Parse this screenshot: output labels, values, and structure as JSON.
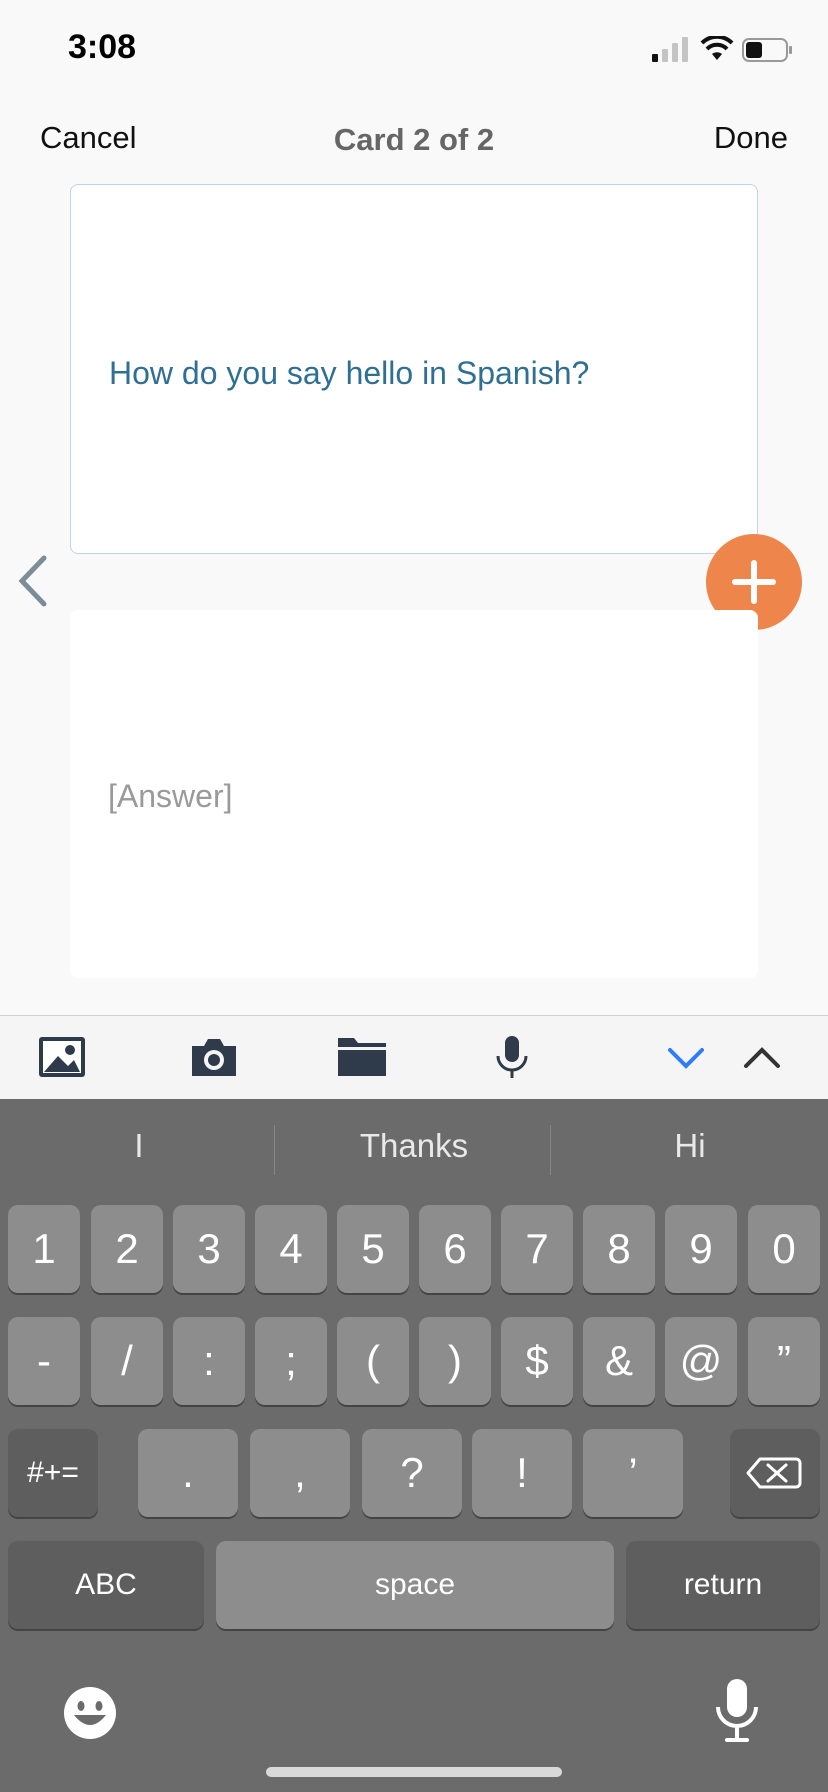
{
  "status": {
    "time": "3:08"
  },
  "nav": {
    "cancel": "Cancel",
    "title": "Card 2 of 2",
    "done": "Done"
  },
  "cards": {
    "front_text": "How do you say hello in Spanish?",
    "back_placeholder": "[Answer]"
  },
  "colors": {
    "accent_orange": "#ee854a",
    "front_text": "#2f6f94",
    "chevron_blue": "#2f7cf6"
  },
  "toolbar": {
    "icons": [
      "image-icon",
      "camera-icon",
      "folder-icon",
      "microphone-icon",
      "chevron-down-icon",
      "chevron-up-icon"
    ]
  },
  "keyboard": {
    "suggestions": [
      "I",
      "Thanks",
      "Hi"
    ],
    "row1": [
      "1",
      "2",
      "3",
      "4",
      "5",
      "6",
      "7",
      "8",
      "9",
      "0"
    ],
    "row2": [
      "-",
      "/",
      ":",
      ";",
      "(",
      ")",
      "$",
      "&",
      "@",
      "”"
    ],
    "symbols_key": "#+=",
    "row3": [
      ".",
      ",",
      "?",
      "!",
      "’"
    ],
    "abc_key": "ABC",
    "space_key": "space",
    "return_key": "return"
  }
}
